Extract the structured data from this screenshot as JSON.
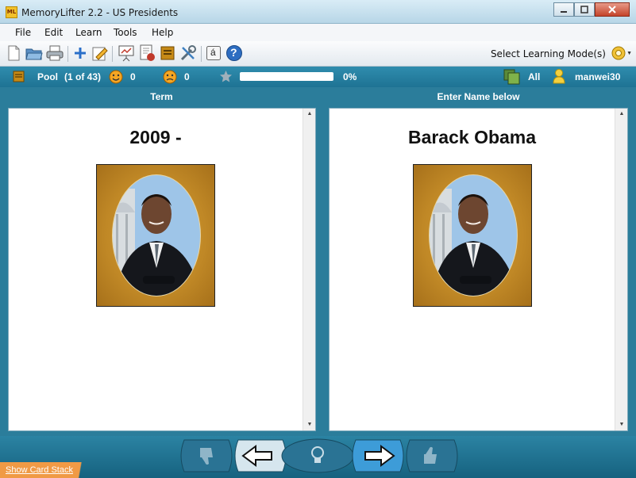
{
  "window": {
    "title": "MemoryLifter 2.2 - US Presidents",
    "app_badge": "ML"
  },
  "menu": [
    "File",
    "Edit",
    "Learn",
    "Tools",
    "Help"
  ],
  "toolbar": {
    "icons": [
      "new-file-icon",
      "open-folder-icon",
      "print-icon",
      "add-card-icon",
      "edit-card-icon",
      "presentation-icon",
      "card-layout-icon",
      "box-icon",
      "tools-icon",
      "special-char-icon",
      "help-icon"
    ],
    "special_char": "á",
    "help_glyph": "?",
    "mode_label": "Select Learning Mode(s)"
  },
  "status": {
    "pool_label": "Pool",
    "pool_count": "(1 of 43)",
    "correct_count": "0",
    "wrong_count": "0",
    "progress_percent_label": "0%",
    "progress_fraction": 0,
    "filter_label": "All",
    "user": "manwei30"
  },
  "cards": {
    "left_header": "Term",
    "right_header": "Enter Name below",
    "question": "2009 -",
    "answer": "Barack Obama"
  },
  "bottom": {
    "show_stack": "Show Card Stack"
  },
  "colors": {
    "frame": "#2f7f9c",
    "accent": "#f09a45",
    "progress": "#ffffff"
  }
}
